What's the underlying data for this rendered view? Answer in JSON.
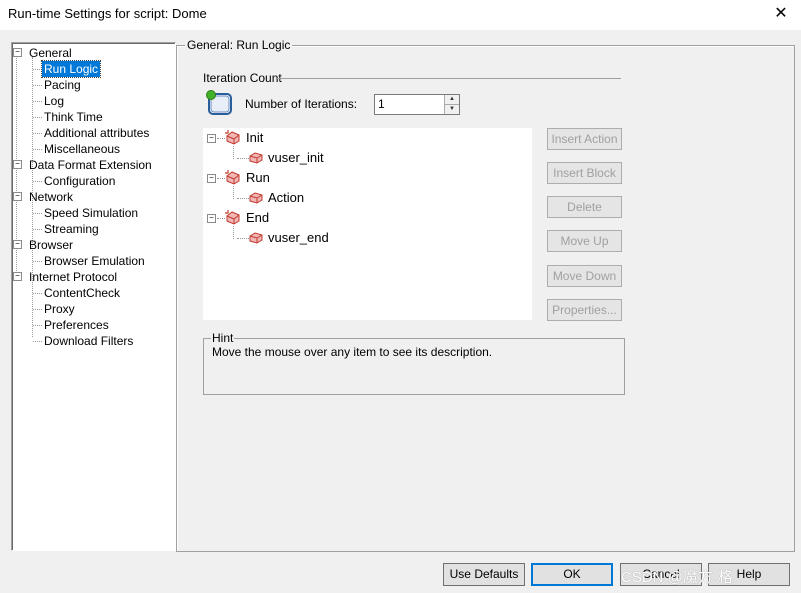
{
  "window": {
    "title": "Run-time Settings for script: Dome",
    "close_glyph": "✕"
  },
  "tree": {
    "general": "General",
    "run_logic": "Run Logic",
    "pacing": "Pacing",
    "log": "Log",
    "think_time": "Think Time",
    "additional_attributes": "Additional attributes",
    "miscellaneous": "Miscellaneous",
    "data_format_extension": "Data Format Extension",
    "configuration": "Configuration",
    "network": "Network",
    "speed_simulation": "Speed Simulation",
    "streaming": "Streaming",
    "browser": "Browser",
    "browser_emulation": "Browser Emulation",
    "internet_protocol": "Internet Protocol",
    "contentcheck": "ContentCheck",
    "proxy": "Proxy",
    "preferences": "Preferences",
    "download_filters": "Download Filters",
    "expander_glyph": "−"
  },
  "panel": {
    "group_title": "General: Run Logic",
    "iteration_count_title": "Iteration Count",
    "iterations_label": "Number of Iterations:",
    "iterations_value": "1"
  },
  "actions": {
    "init": "Init",
    "vuser_init": "vuser_init",
    "run": "Run",
    "action": "Action",
    "end": "End",
    "vuser_end": "vuser_end"
  },
  "side_buttons": {
    "insert_action": "Insert Action",
    "insert_block": "Insert Block",
    "delete": "Delete",
    "move_up": "Move Up",
    "move_down": "Move Down",
    "properties": "Properties..."
  },
  "hint": {
    "title": "Hint",
    "text": "Move the mouse over any item to see its description."
  },
  "buttons": {
    "use_defaults": "Use Defaults",
    "ok": "OK",
    "cancel": "Cancel",
    "help": "Help"
  },
  "watermark": "CSDN @魔方·格",
  "colors": {
    "selection": "#0078d7",
    "block_icon": "#d9534f",
    "disabled_text": "#a0a0a0"
  }
}
